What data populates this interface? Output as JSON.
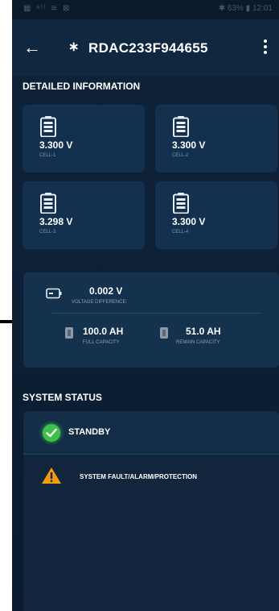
{
  "statusbar": {
    "left": "▦ ᵃˡˡ ≋ ⊠",
    "right": "✱ 63% ▮ 12:01"
  },
  "header": {
    "title": "RDAC233F944655"
  },
  "detailed": {
    "heading": "DETAILED INFORMATION",
    "cells": [
      {
        "voltage": "3.300 V",
        "label": "CELL-1"
      },
      {
        "voltage": "3.300 V",
        "label": "CELL-2"
      },
      {
        "voltage": "3.298 V",
        "label": "CELL-3"
      },
      {
        "voltage": "3.300 V",
        "label": "CELL-4"
      }
    ]
  },
  "summary": {
    "voltage_difference": "0.002 V",
    "voltage_difference_label": "VOLTAGE DIFFERENCE:",
    "full_capacity": "100.0 AH",
    "full_capacity_label": "FULL CAPACITY",
    "remain_capacity": "51.0 AH",
    "remain_capacity_label": "REMAIN CAPACITY"
  },
  "system_status": {
    "heading": "SYSTEM STATUS",
    "state": "STANDBY",
    "fault": "SYSTEM FAULT/ALARM/PROTECTION"
  },
  "colors": {
    "background": "#0e2136",
    "card": "#13314f",
    "ok": "#3ec14a",
    "warning": "#f39c12"
  },
  "icons": [
    "arrow-left-icon",
    "bluetooth-icon",
    "more-vert-icon",
    "battery-icon",
    "battery-horizontal-icon",
    "check-circle-icon",
    "warning-triangle-icon"
  ]
}
